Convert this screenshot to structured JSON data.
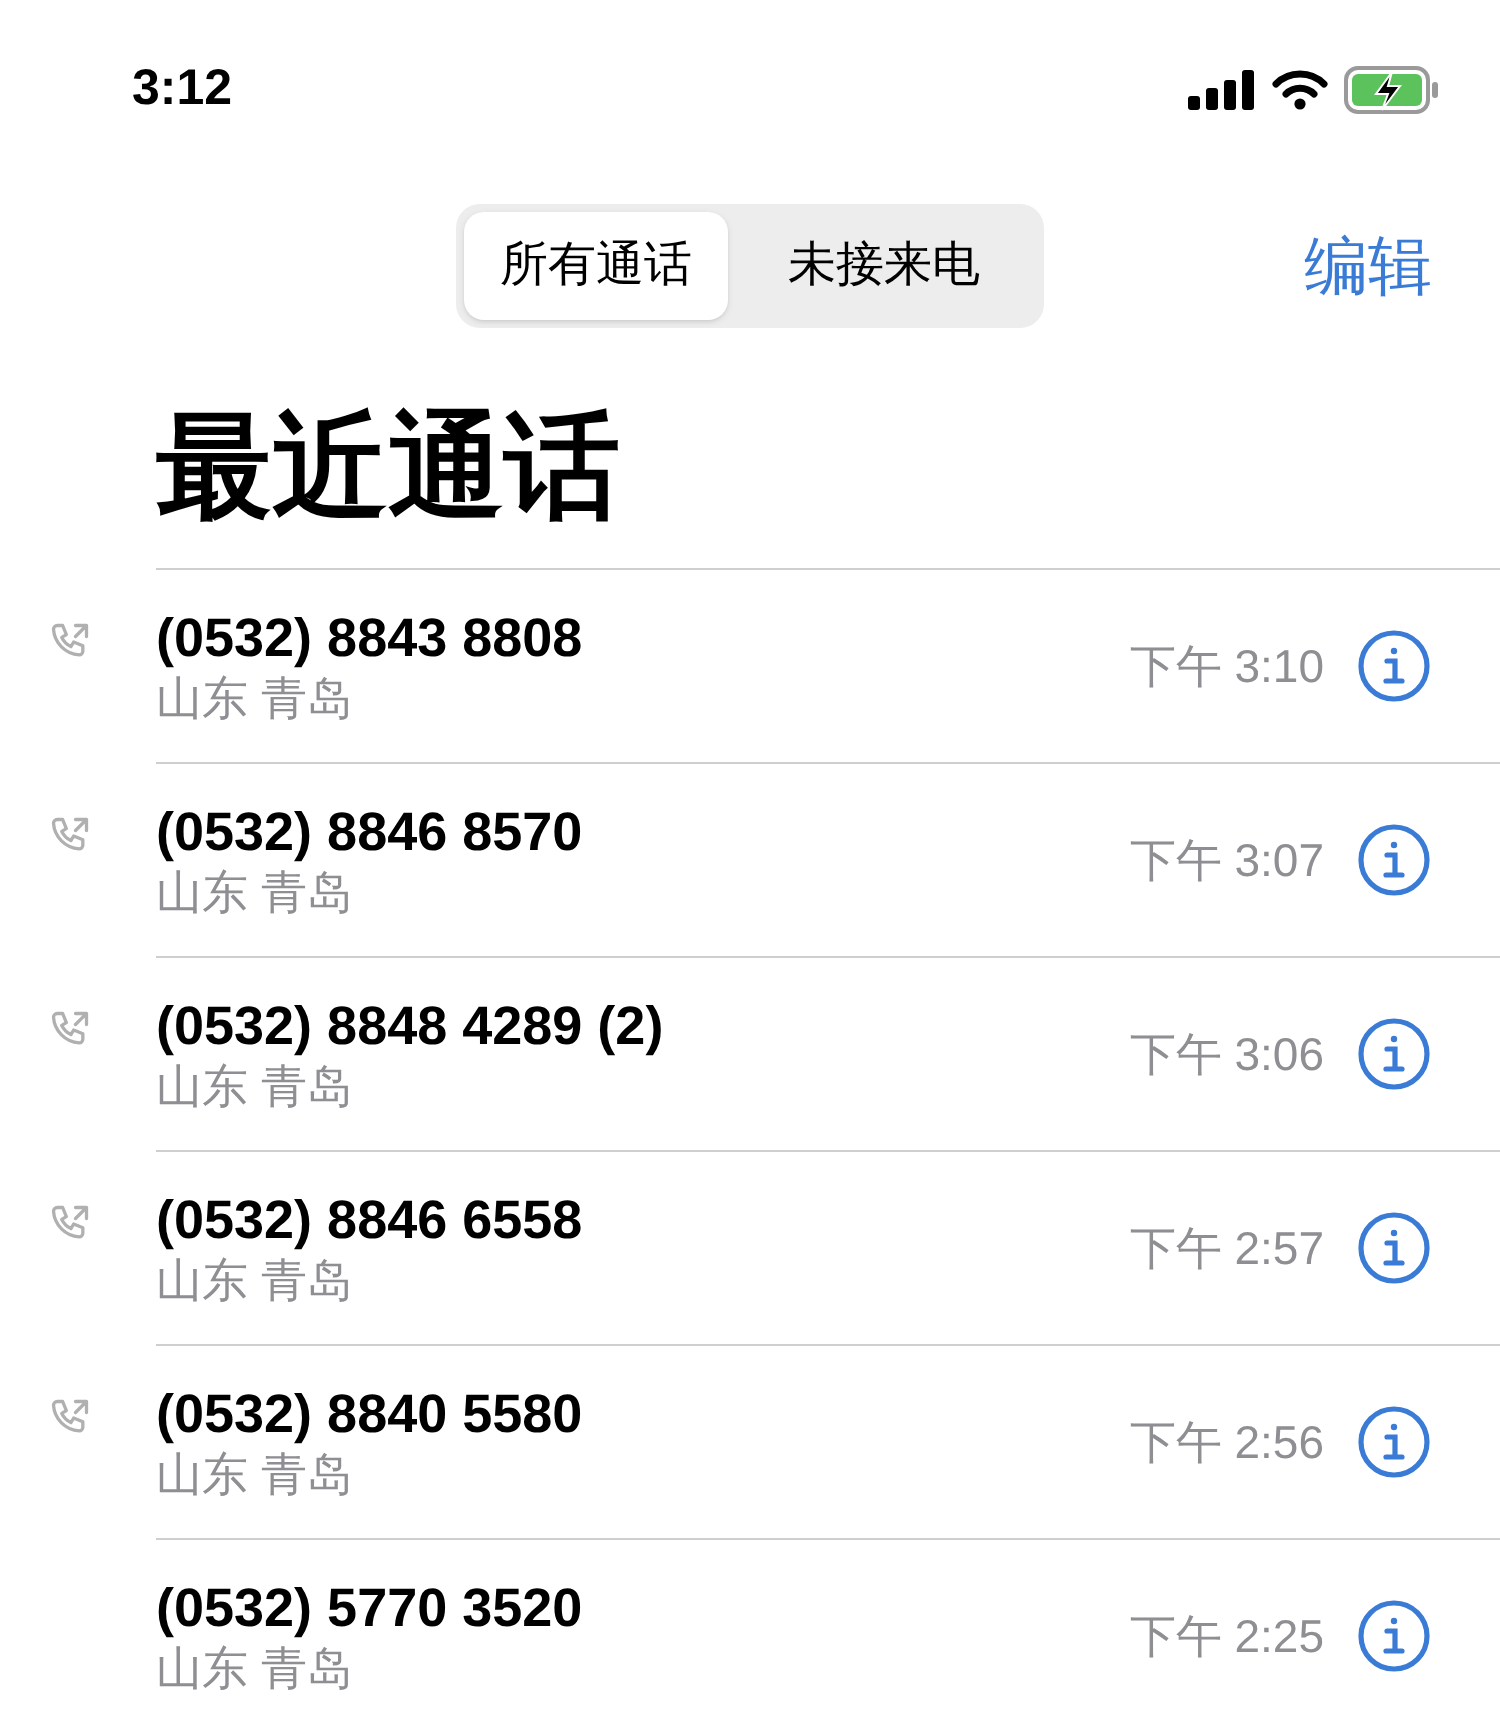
{
  "status_bar": {
    "time": "3:12"
  },
  "segments": [
    {
      "label": "所有通话",
      "selected": true
    },
    {
      "label": "未接来电",
      "selected": false
    }
  ],
  "edit": "编辑",
  "title": "最近通话",
  "calls": [
    {
      "number": "(0532) 8843 8808",
      "location": "山东 青岛",
      "time": "下午 3:10",
      "outgoing": true
    },
    {
      "number": "(0532) 8846 8570",
      "location": "山东 青岛",
      "time": "下午 3:07",
      "outgoing": true
    },
    {
      "number": "(0532) 8848 4289 (2)",
      "location": "山东 青岛",
      "time": "下午 3:06",
      "outgoing": true
    },
    {
      "number": "(0532) 8846 6558",
      "location": "山东 青岛",
      "time": "下午 2:57",
      "outgoing": true
    },
    {
      "number": "(0532) 8840 5580",
      "location": "山东 青岛",
      "time": "下午 2:56",
      "outgoing": true
    },
    {
      "number": "(0532) 5770 3520",
      "location": "山东 青岛",
      "time": "下午 2:25",
      "outgoing": false
    }
  ]
}
